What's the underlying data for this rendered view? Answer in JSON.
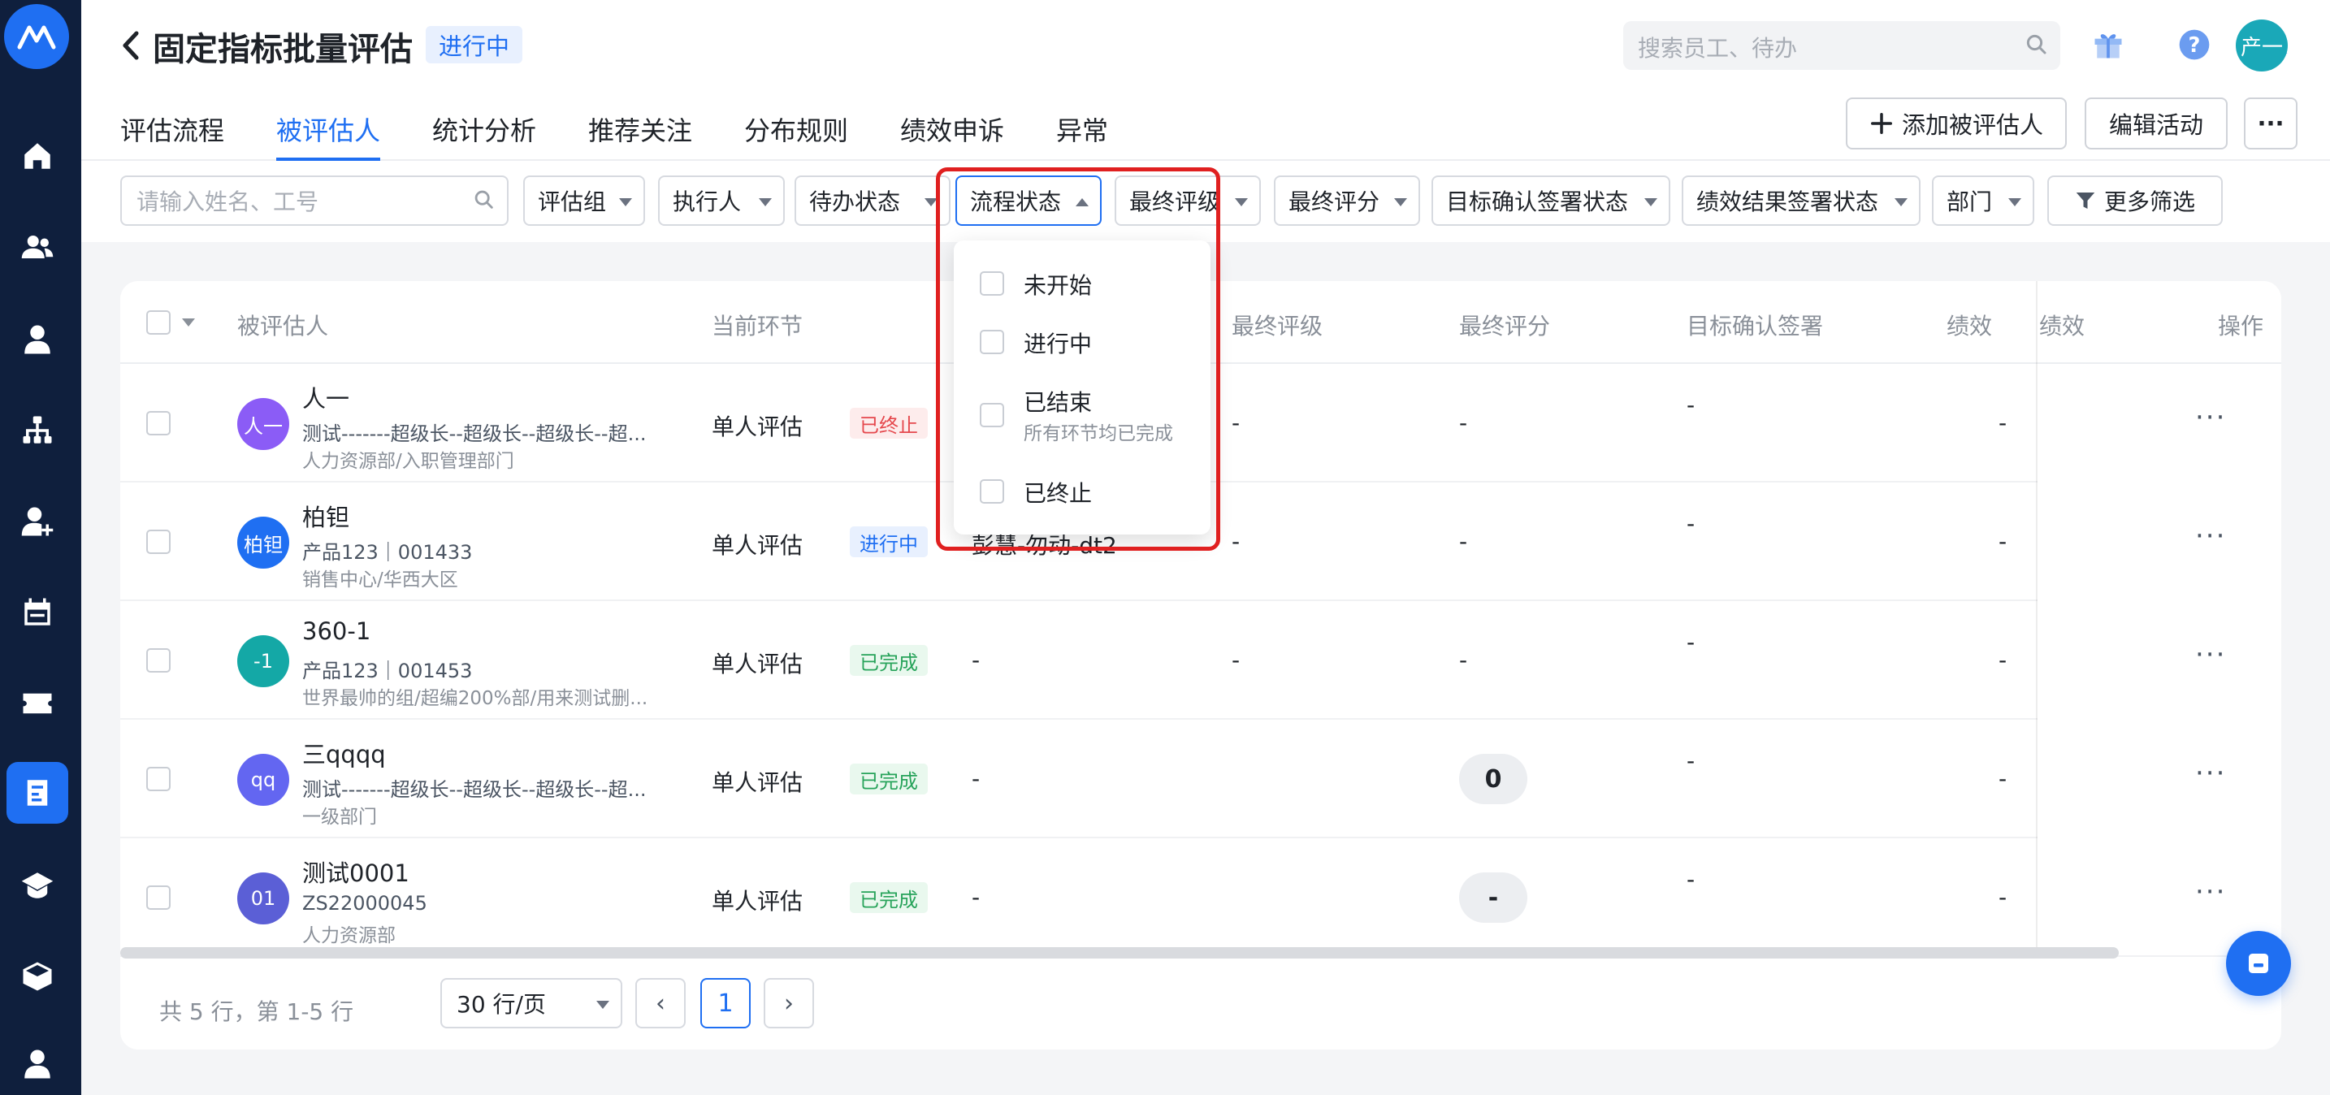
{
  "header": {
    "title": "固定指标批量评估",
    "status_badge": "进行中",
    "search_placeholder": "搜索员工、待办",
    "user_avatar": "产一"
  },
  "tabs": [
    {
      "label": "评估流程"
    },
    {
      "label": "被评估人",
      "active": true
    },
    {
      "label": "统计分析"
    },
    {
      "label": "推荐关注"
    },
    {
      "label": "分布规则"
    },
    {
      "label": "绩效申诉"
    },
    {
      "label": "异常"
    }
  ],
  "actions": {
    "add_label": "添加被评估人",
    "edit_label": "编辑活动",
    "more_label": "···"
  },
  "filters": {
    "search_placeholder": "请输入姓名、工号",
    "items": [
      "评估组",
      "执行人",
      "待办状态",
      "流程状态",
      "最终评级",
      "最终评分",
      "目标确认签署状态",
      "绩效结果签署状态",
      "部门"
    ],
    "more_label": "更多筛选"
  },
  "dropdown": {
    "options": [
      {
        "label": "未开始"
      },
      {
        "label": "进行中"
      },
      {
        "label": "已结束",
        "sub": "所有环节均已完成"
      },
      {
        "label": "已终止"
      }
    ]
  },
  "table": {
    "headers": [
      "被评估人",
      "当前环节",
      "最终评级",
      "最终评分",
      "目标确认签署",
      "绩效",
      "操作"
    ],
    "rows": [
      {
        "avatar": "人一",
        "avatar_color": "#8b5cf6",
        "name": "人一",
        "sub": "测试-------超级长--超级长--超级长--超...",
        "dept": "人力资源部/入职管理部门",
        "stage": "单人评估",
        "stage_status": "已终止",
        "executor": "",
        "rating": "-",
        "score": "-",
        "target_sign": "-",
        "perf": "-"
      },
      {
        "avatar": "柏钽",
        "avatar_color": "#1f6ff2",
        "name": "柏钽",
        "sub": "产品123｜001433",
        "dept": "销售中心/华西大区",
        "stage": "单人评估",
        "stage_status": "进行中",
        "executor": "彭慧-勿动-dt2",
        "rating": "-",
        "score": "-",
        "target_sign": "-",
        "perf": "-"
      },
      {
        "avatar": "-1",
        "avatar_color": "#14a8a6",
        "name": "360-1",
        "sub": "产品123｜001453",
        "dept": "世界最帅的组/超编200%部/用来测试删...",
        "stage": "单人评估",
        "stage_status": "已完成",
        "executor": "-",
        "rating": "-",
        "score": "-",
        "target_sign": "-",
        "perf": "-"
      },
      {
        "avatar": "qq",
        "avatar_color": "#6366f1",
        "name": "三qqqq",
        "sub": "测试-------超级长--超级长--超级长--超...",
        "dept": "一级部门",
        "stage": "单人评估",
        "stage_status": "已完成",
        "executor": "-",
        "rating": "",
        "score": "0",
        "target_sign": "-",
        "perf": "-"
      },
      {
        "avatar": "01",
        "avatar_color": "#5b5fd6",
        "name": "测试0001",
        "sub": "ZS22000045",
        "dept": "人力资源部",
        "stage": "单人评估",
        "stage_status": "已完成",
        "executor": "-",
        "rating": "",
        "score": "-",
        "target_sign": "-",
        "perf": "-"
      }
    ],
    "row_more": "···"
  },
  "pagination": {
    "summary": "共 5 行，第 1-5 行",
    "page_size": "30 行/页",
    "prev": "‹",
    "current": "1",
    "next": "›"
  }
}
